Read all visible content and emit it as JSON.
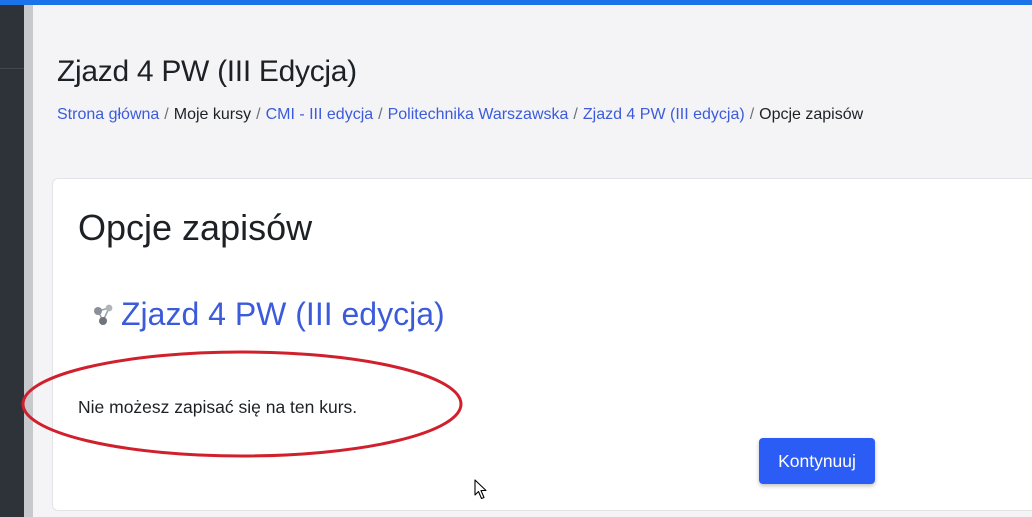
{
  "page": {
    "title": "Zjazd 4 PW (III Edycja)"
  },
  "breadcrumb": [
    {
      "label": "Strona główna",
      "link": true
    },
    {
      "label": "Moje kursy",
      "link": false
    },
    {
      "label": "CMI - III edycja",
      "link": true
    },
    {
      "label": "Politechnika Warszawska",
      "link": true
    },
    {
      "label": "Zjazd 4 PW (III edycja)",
      "link": true
    },
    {
      "label": "Opcje zapisów",
      "link": false
    }
  ],
  "enrolment": {
    "heading": "Opcje zapisów",
    "course_name": "Zjazd 4 PW (III edycja)",
    "course_icon": "course-network-icon",
    "message": "Nie możesz zapisać się na ten kurs.",
    "continue_label": "Kontynuuj"
  },
  "colors": {
    "accent": "#1a73e8",
    "link": "#3b5bdb",
    "primary_button": "#2b5cf6",
    "annotation_ellipse": "#d0202c",
    "drawer": "#2d3338"
  }
}
